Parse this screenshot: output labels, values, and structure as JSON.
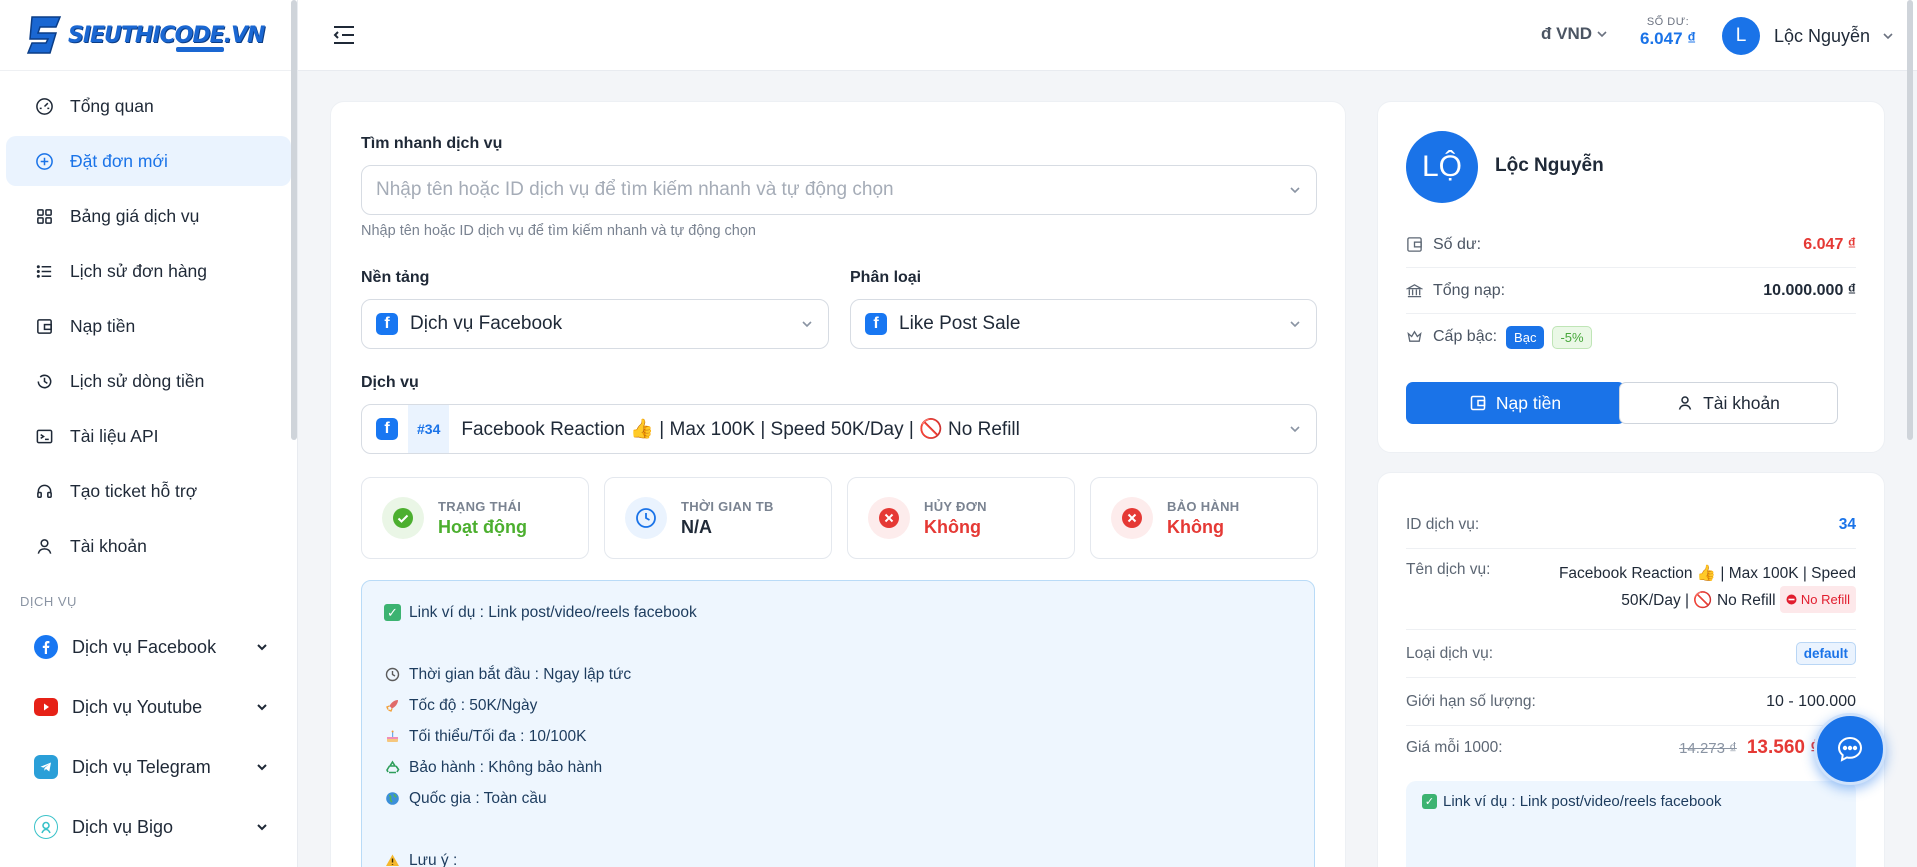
{
  "brand": {
    "logo_text": "SIEUTHICODE.VN"
  },
  "sidebar": {
    "items": [
      {
        "label": "Tổng quan",
        "icon": "gauge-icon"
      },
      {
        "label": "Đặt đơn mới",
        "icon": "plus-circle-icon"
      },
      {
        "label": "Bảng giá dịch vụ",
        "icon": "grid-icon"
      },
      {
        "label": "Lịch sử đơn hàng",
        "icon": "list-icon"
      },
      {
        "label": "Nạp tiền",
        "icon": "wallet-icon"
      },
      {
        "label": "Lịch sử dòng tiền",
        "icon": "history-icon"
      },
      {
        "label": "Tài liệu API",
        "icon": "terminal-icon"
      },
      {
        "label": "Tạo ticket hỗ trợ",
        "icon": "headset-icon"
      },
      {
        "label": "Tài khoản",
        "icon": "user-icon"
      }
    ],
    "section_label": "DỊCH VỤ",
    "services": [
      {
        "label": "Dịch vụ Facebook",
        "icon": "facebook-icon"
      },
      {
        "label": "Dịch vụ Youtube",
        "icon": "youtube-icon"
      },
      {
        "label": "Dịch vụ Telegram",
        "icon": "telegram-icon"
      },
      {
        "label": "Dịch vụ Bigo",
        "icon": "bigo-icon"
      }
    ]
  },
  "topbar": {
    "currency": "đ VND",
    "balance_caption": "SỐ DƯ:",
    "balance_value": "6.047 ₫",
    "avatar_letter": "L",
    "user_name": "Lộc Nguyễn"
  },
  "form": {
    "quick_search_label": "Tìm nhanh dịch vụ",
    "quick_search_placeholder": "Nhập tên hoặc ID dịch vụ để tìm kiếm nhanh và tự động chọn",
    "quick_search_hint": "Nhập tên hoặc ID dịch vụ để tìm kiếm nhanh và tự động chọn",
    "platform_label": "Nền tảng",
    "platform_value": "Dịch vụ Facebook",
    "category_label": "Phân loại",
    "category_value": "Like Post Sale",
    "service_label": "Dịch vụ",
    "service_id": "#34",
    "service_value": "Facebook Reaction 👍 | Max 100K | Speed 50K/Day | 🚫 No Refill"
  },
  "stats": [
    {
      "caption": "TRẠNG THÁI",
      "value": "Hoạt động",
      "icon": "check-circle-icon",
      "color": "#4caf2f"
    },
    {
      "caption": "THỜI GIAN TB",
      "value": "N/A",
      "icon": "clock-icon",
      "color": "#1f2937"
    },
    {
      "caption": "HỦY ĐƠN",
      "value": "Không",
      "icon": "x-circle-icon",
      "color": "#e53935"
    },
    {
      "caption": "BẢO HÀNH",
      "value": "Không",
      "icon": "x-circle-icon",
      "color": "#e53935"
    }
  ],
  "description": {
    "lines": [
      "Link ví dụ : Link post/video/reels facebook",
      "",
      "Thời gian bắt đầu : Ngay lập tức",
      "Tốc độ : 50K/Ngày",
      "Tối thiểu/Tối đa : 10/100K",
      "Bảo hành : Không bảo hành",
      "Quốc gia : Toàn cầu",
      "",
      "Lưu ý :"
    ]
  },
  "profile": {
    "avatar_text": "LỘ",
    "name": "Lộc Nguyễn",
    "balance_label": "Số dư:",
    "balance_value": "6.047 ₫",
    "total_label": "Tổng nạp:",
    "total_value": "10.000.000 ₫",
    "rank_label": "Cấp bậc:",
    "rank_value": "Bạc",
    "rank_discount": "-5%",
    "deposit_button": "Nạp tiền",
    "account_button": "Tài khoản"
  },
  "service_info": {
    "id_label": "ID dịch vụ:",
    "id_value": "34",
    "name_label": "Tên dịch vụ:",
    "name_value_line1": "Facebook Reaction 👍 | Max 100K | Speed",
    "name_value_line2": "50K/Day | 🚫 No Refill",
    "name_tag": "No Refill",
    "type_label": "Loại dịch vụ:",
    "type_value": "default",
    "limit_label": "Giới hạn số lượng:",
    "limit_value": "10 - 100.000",
    "price_label": "Giá mỗi 1000:",
    "price_old": "14.273 ₫",
    "price_new": "13.560 ₫",
    "desc_line": "Link ví dụ : Link post/video/reels facebook"
  },
  "colors": {
    "primary": "#1a73e8",
    "danger": "#e53935",
    "success": "#4caf2f"
  }
}
